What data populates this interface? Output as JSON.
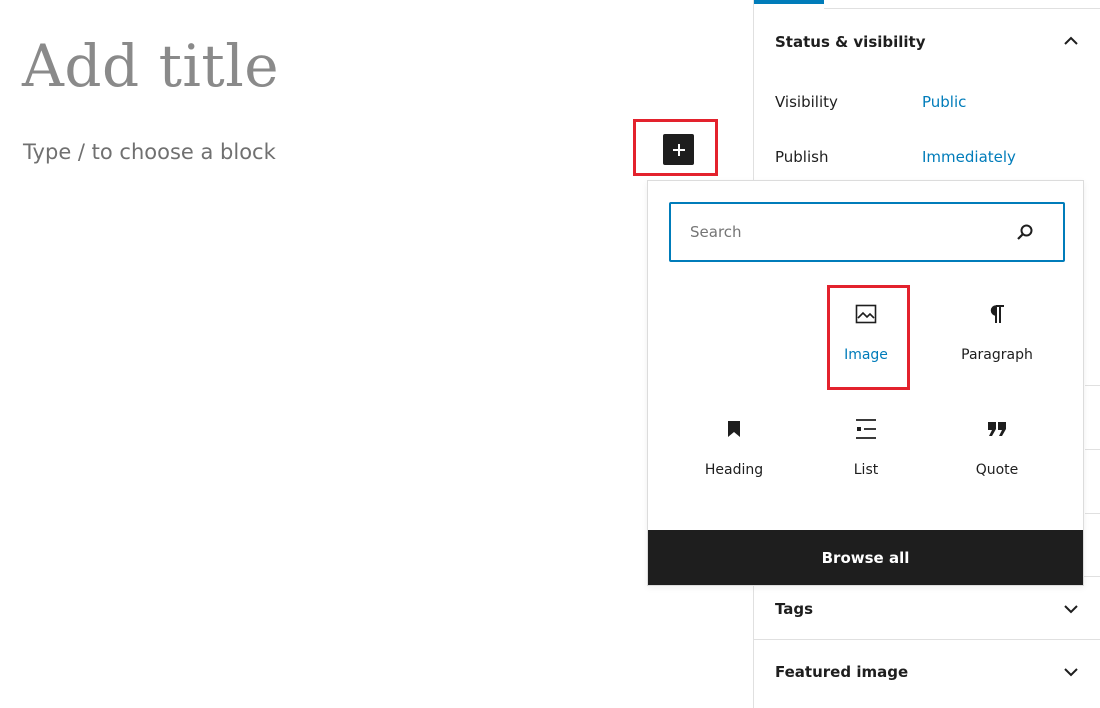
{
  "editor": {
    "title_placeholder": "Add title",
    "block_placeholder": "Type / to choose a block"
  },
  "sidebar": {
    "status_panel": {
      "title": "Status & visibility",
      "rows": [
        {
          "label": "Visibility",
          "value": "Public"
        },
        {
          "label": "Publish",
          "value": "Immediately"
        }
      ]
    },
    "tags_panel": {
      "title": "Tags"
    },
    "featured_panel": {
      "title": "Featured image"
    }
  },
  "inserter": {
    "search_placeholder": "Search",
    "blocks": [
      {
        "label": "Image",
        "icon": "image-icon",
        "selected": true
      },
      {
        "label": "Paragraph",
        "icon": "paragraph-icon"
      },
      {
        "label": "Heading",
        "icon": "bookmark-icon"
      },
      {
        "label": "List",
        "icon": "list-icon"
      },
      {
        "label": "Quote",
        "icon": "quote-icon"
      }
    ],
    "browse_all_label": "Browse all"
  },
  "colors": {
    "accent": "#007cba",
    "dark": "#1e1e1e",
    "highlight": "#e3222d"
  }
}
